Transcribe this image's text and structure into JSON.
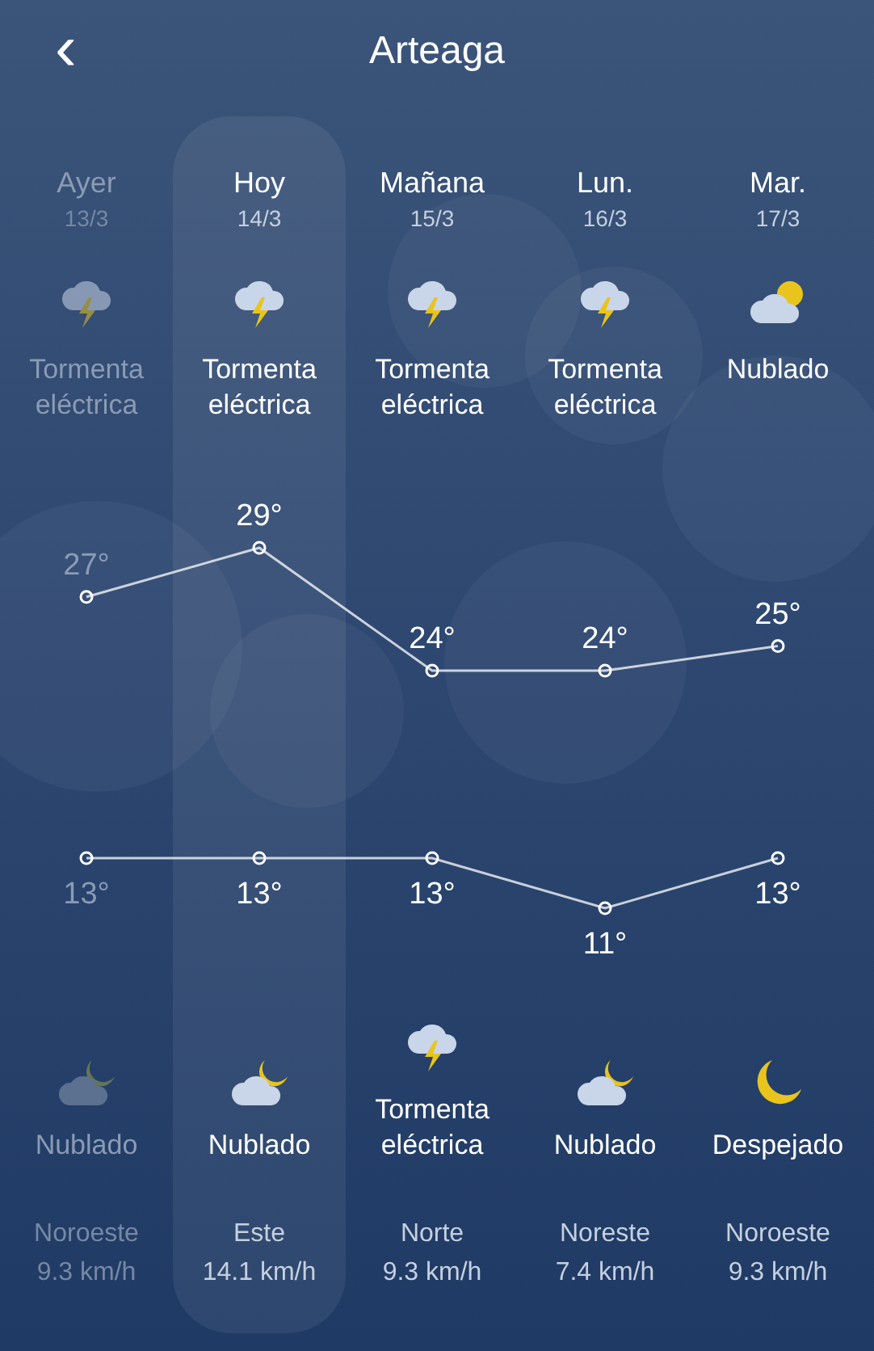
{
  "header": {
    "title": "Arteaga",
    "back": "‹"
  },
  "days": [
    {
      "name": "Ayer",
      "date": "13/3",
      "past": true,
      "selected": false,
      "day_icon": {
        "kind": "storm"
      },
      "day_condition": "Tormenta eléctrica",
      "night_icon": {
        "kind": "cloudy_moon"
      },
      "night_condition": "Nublado",
      "wind_direction": "Noroeste",
      "wind_speed": "9.3 km/h"
    },
    {
      "name": "Hoy",
      "date": "14/3",
      "past": false,
      "selected": true,
      "day_icon": {
        "kind": "storm"
      },
      "day_condition": "Tormenta eléctrica",
      "night_icon": {
        "kind": "cloudy_moon"
      },
      "night_condition": "Nublado",
      "wind_direction": "Este",
      "wind_speed": "14.1 km/h"
    },
    {
      "name": "Mañana",
      "date": "15/3",
      "past": false,
      "selected": false,
      "day_icon": {
        "kind": "storm"
      },
      "day_condition": "Tormenta eléctrica",
      "night_icon": {
        "kind": "storm"
      },
      "night_condition": "Tormenta eléctrica",
      "wind_direction": "Norte",
      "wind_speed": "9.3 km/h"
    },
    {
      "name": "Lun.",
      "date": "16/3",
      "past": false,
      "selected": false,
      "day_icon": {
        "kind": "storm"
      },
      "day_condition": "Tormenta eléctrica",
      "night_icon": {
        "kind": "cloudy_moon"
      },
      "night_condition": "Nublado",
      "wind_direction": "Noreste",
      "wind_speed": "7.4 km/h"
    },
    {
      "name": "Mar.",
      "date": "17/3",
      "past": false,
      "selected": false,
      "day_icon": {
        "kind": "cloudy_sun"
      },
      "day_condition": "Nublado",
      "night_icon": {
        "kind": "clear_night"
      },
      "night_condition": "Despejado",
      "wind_direction": "Noroeste",
      "wind_speed": "9.3 km/h"
    }
  ],
  "max_temperatures": {
    "chart_data": {
      "type": "line",
      "data_labels": true,
      "series": [
        {
          "color": "#ffffff",
          "marker": "o",
          "values": [
            27,
            29,
            24,
            24,
            25
          ],
          "value_labels": [
            "27°",
            "29°",
            "24°",
            "24°",
            "25°"
          ]
        }
      ]
    }
  },
  "min_temperatures": {
    "chart_data": {
      "type": "line",
      "data_labels": true,
      "series": [
        {
          "color": "#ffffff",
          "marker": "o",
          "values": [
            13,
            13,
            13,
            11,
            13
          ],
          "value_labels": [
            "13°",
            "13°",
            "13°",
            "11°",
            "13°"
          ]
        }
      ]
    }
  }
}
